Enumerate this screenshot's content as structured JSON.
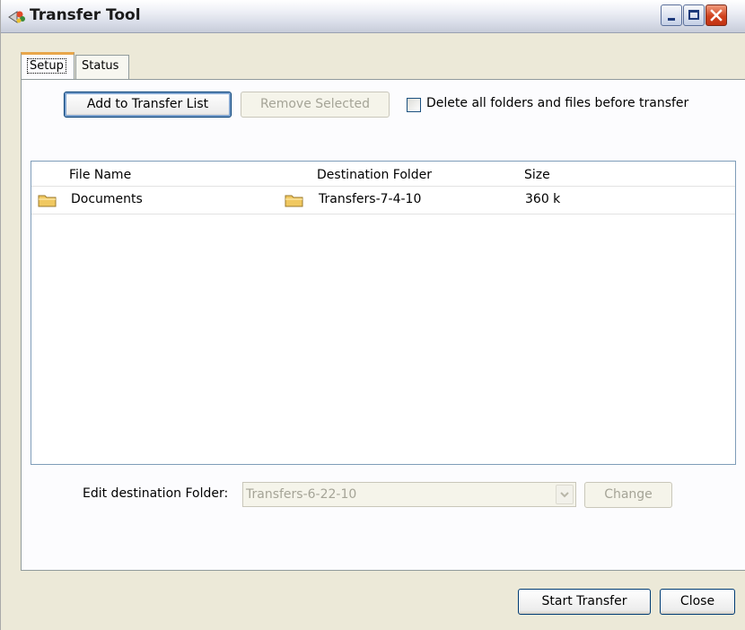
{
  "window": {
    "title": "Transfer Tool",
    "icon": "transfer-tool-icon"
  },
  "tabs": [
    {
      "label": "Setup",
      "selected": true
    },
    {
      "label": "Status",
      "selected": false
    }
  ],
  "setup": {
    "add_button": "Add to Transfer List",
    "remove_button": "Remove Selected",
    "delete_checkbox_label": "Delete all folders and files before transfer",
    "delete_checkbox_checked": false,
    "columns": [
      "File Name",
      "Destination Folder",
      "Size"
    ],
    "rows": [
      {
        "file_name": "Documents",
        "destination": "Transfers-7-4-10",
        "size": "360 k"
      }
    ],
    "edit_dest_label": "Edit destination Folder:",
    "edit_dest_value": "Transfers-6-22-10",
    "change_button": "Change"
  },
  "footer": {
    "start_button": "Start Transfer",
    "close_button": "Close"
  },
  "colors": {
    "accent_tab": "#e8a64a",
    "close_red": "#c23313",
    "folder": "#f0c860"
  }
}
